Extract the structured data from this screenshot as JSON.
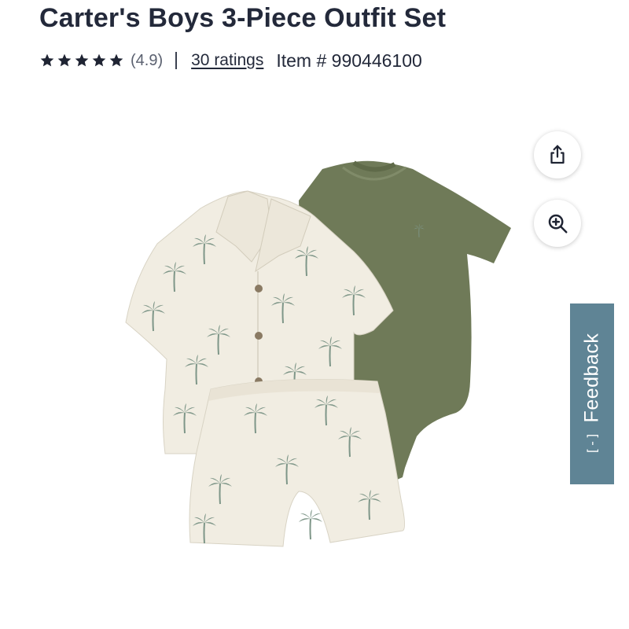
{
  "product": {
    "title": "Carter's Boys 3-Piece Outfit Set",
    "rating_value": "(4.9)",
    "star_count": 5,
    "ratings_link": "30 ratings",
    "item_number": "Item # 990446100",
    "image_alt": "Palm print shirt, shorts and olive bodysuit"
  },
  "actions": {
    "share_icon": "share-icon",
    "zoom_icon": "zoom-in-icon"
  },
  "feedback": {
    "label": "Feedback",
    "icon": "[-]"
  },
  "colors": {
    "title": "#23293a",
    "feedback_tab": "#5f8495",
    "bodysuit": "#6f7a58",
    "shirt": "#f1ede2",
    "palm_print": "#7e9688"
  }
}
